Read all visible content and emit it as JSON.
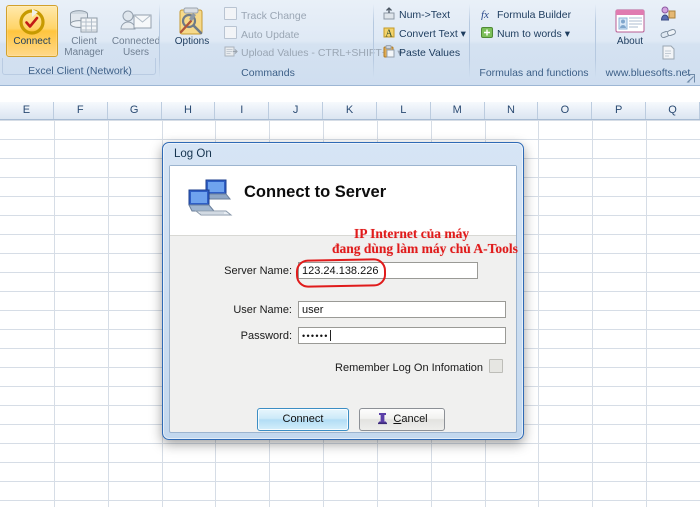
{
  "ribbon": {
    "groups": [
      {
        "name": "excel-client",
        "label": "Excel Client (Network)",
        "buttons": [
          {
            "label_line1": "Connect",
            "label_line2": "",
            "icon": "connect-refresh-icon",
            "selected": true,
            "disabled": false
          },
          {
            "label_line1": "Client",
            "label_line2": "Manager",
            "icon": "client-manager-icon",
            "selected": false,
            "disabled": true
          },
          {
            "label_line1": "Connected",
            "label_line2": "Users",
            "icon": "connected-users-icon",
            "selected": false,
            "disabled": true
          }
        ]
      },
      {
        "name": "commands",
        "label": "Commands",
        "big": {
          "label_line1": "Options",
          "icon": "options-tools-icon"
        },
        "items": [
          {
            "label": "Track Change",
            "icon": "checkbox-icon",
            "disabled": true
          },
          {
            "label": "Auto Update",
            "icon": "checkbox-icon",
            "disabled": true
          },
          {
            "label": "Upload Values - CTRL+SHIFT+Z",
            "icon": "upload-icon",
            "disabled": true,
            "dropdown": true
          }
        ]
      },
      {
        "name": "text-tools",
        "label": "",
        "items": [
          {
            "label": "Num->Text",
            "icon": "num-to-text-icon",
            "disabled": false
          },
          {
            "label": "Convert Text",
            "icon": "convert-text-icon",
            "disabled": false,
            "dropdown": true
          },
          {
            "label": "Paste Values",
            "icon": "paste-values-icon",
            "disabled": false
          }
        ]
      },
      {
        "name": "formulas-and-functions",
        "label": "Formulas and functions",
        "items": [
          {
            "label": "Formula Builder",
            "icon": "fx-icon",
            "disabled": false
          },
          {
            "label": "Num to words",
            "icon": "num-to-words-icon",
            "disabled": false,
            "dropdown": true
          }
        ]
      },
      {
        "name": "bluesofts",
        "label": "www.bluesofts.net",
        "big": {
          "label_line1": "About",
          "icon": "about-window-icon"
        },
        "side_icons": [
          "help-person-icon",
          "link-icon",
          "document-icon"
        ],
        "dialog_launcher": "dialog-launcher-icon"
      }
    ]
  },
  "sheet": {
    "columns": [
      "E",
      "F",
      "G",
      "H",
      "I",
      "J",
      "K",
      "L",
      "M",
      "N",
      "O",
      "P",
      "Q"
    ]
  },
  "dialog": {
    "title": "Log On",
    "heading": "Connect to Server",
    "header_icon": "two-computers-server-icon",
    "annotation": {
      "line1": "IP Internet của máy",
      "line2": "đang dùng làm máy chủ A-Tools",
      "color": "#e01b1b"
    },
    "fields": [
      {
        "label": "Server Name:",
        "value": "123.24.138.226",
        "placeholder": "",
        "name": "server-name"
      },
      {
        "label": "User Name:",
        "value": "user",
        "placeholder": "",
        "name": "user-name"
      },
      {
        "label": "Password:",
        "value": "••••••",
        "placeholder": "",
        "name": "password"
      }
    ],
    "remember": {
      "label": "Remember Log On Infomation",
      "checked": false
    },
    "buttons": {
      "connect": "Connect",
      "cancel_prefix": "",
      "cancel_accel": "C",
      "cancel_rest": "ancel"
    }
  }
}
